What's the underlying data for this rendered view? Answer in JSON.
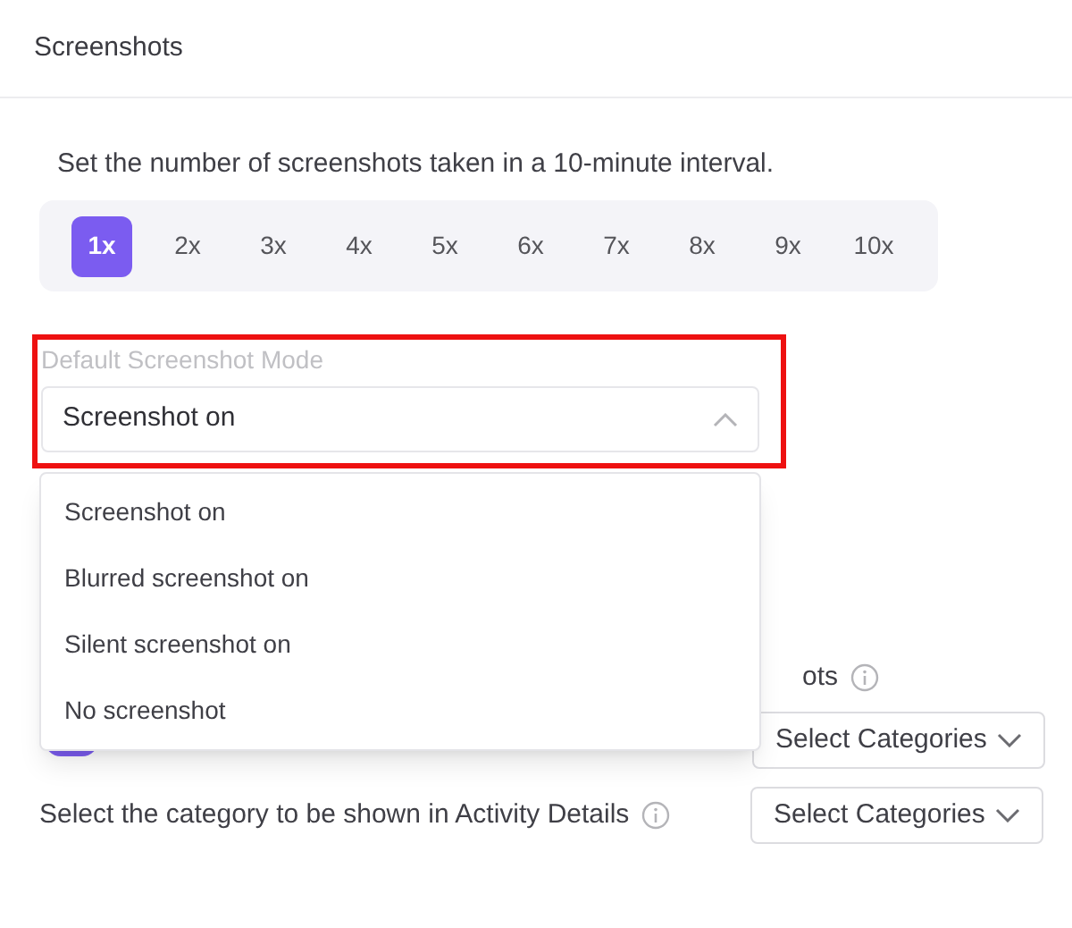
{
  "header": {
    "title": "Screenshots"
  },
  "frequency": {
    "description": "Set the number of screenshots taken in a 10-minute interval.",
    "options": [
      {
        "label": "1x",
        "selected": true
      },
      {
        "label": "2x",
        "selected": false
      },
      {
        "label": "3x",
        "selected": false
      },
      {
        "label": "4x",
        "selected": false
      },
      {
        "label": "5x",
        "selected": false
      },
      {
        "label": "6x",
        "selected": false
      },
      {
        "label": "7x",
        "selected": false
      },
      {
        "label": "8x",
        "selected": false
      },
      {
        "label": "9x",
        "selected": false
      },
      {
        "label": "10x",
        "selected": false
      }
    ]
  },
  "mode": {
    "label": "Default Screenshot Mode",
    "value": "Screenshot on",
    "expanded": true,
    "highlighted": true,
    "options": [
      "Screenshot on",
      "Blurred screenshot on",
      "Silent screenshot on",
      "No screenshot"
    ]
  },
  "hidden_setting": {
    "label": "ots",
    "toggle_on": true,
    "select": "Select Categories"
  },
  "activity_setting": {
    "label": "Select the category to be shown in Activity Details",
    "select": "Select Categories"
  }
}
